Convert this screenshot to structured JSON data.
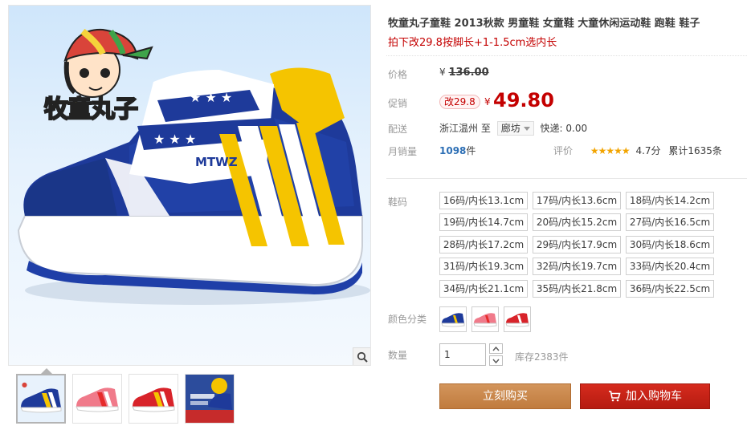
{
  "gallery": {
    "logo_text": "牧童丸子",
    "shoe_brand_text": "MTWZ",
    "zoom_icon": "magnifier-icon",
    "thumbnails": [
      {
        "name": "blue-yellow-shoe-thumb"
      },
      {
        "name": "pink-red-shoe-thumb"
      },
      {
        "name": "red-white-shoe-thumb"
      },
      {
        "name": "promo-poster-thumb"
      }
    ]
  },
  "product": {
    "title": "牧童丸子童鞋 2013秋款 男童鞋 女童鞋 大童休闲运动鞋 跑鞋 鞋子",
    "subtitle": "拍下改29.8按脚长+1-1.5cm选内长"
  },
  "price": {
    "label": "价格",
    "currency": "¥",
    "original": "136.00",
    "promo_label": "促销",
    "promo_badge": "改29.8",
    "current": "49.80"
  },
  "delivery": {
    "label": "配送",
    "from": "浙江温州",
    "to_word": "至",
    "city": "廊坊",
    "express": "快递: 0.00"
  },
  "sales": {
    "label": "月销量",
    "count": "1098",
    "unit": "件",
    "rating_label": "评价",
    "stars": "★★★★★",
    "score": "4.7分",
    "total": "累计1635条"
  },
  "sizes": {
    "label": "鞋码",
    "options": [
      "16码/内长13.1cm",
      "17码/内长13.6cm",
      "18码/内长14.2cm",
      "19码/内长14.7cm",
      "20码/内长15.2cm",
      "27码/内长16.5cm",
      "28码/内长17.2cm",
      "29码/内长17.9cm",
      "30码/内长18.6cm",
      "31码/内长19.3cm",
      "32码/内长19.7cm",
      "33码/内长20.4cm",
      "34码/内长21.1cm",
      "35码/内长21.8cm",
      "36码/内长22.5cm"
    ]
  },
  "colors": {
    "label": "颜色分类",
    "swatches": [
      "blue-yellow",
      "pink-red",
      "red-white"
    ]
  },
  "quantity": {
    "label": "数量",
    "value": "1",
    "stock": "库存2383件"
  },
  "actions": {
    "buy_now": "立刻购买",
    "add_cart": "加入购物车"
  },
  "theme": {
    "price_red": "#c40000",
    "buy_brown": "#c88548",
    "cart_red": "#c4251a",
    "link_blue": "#2d6fb5"
  }
}
